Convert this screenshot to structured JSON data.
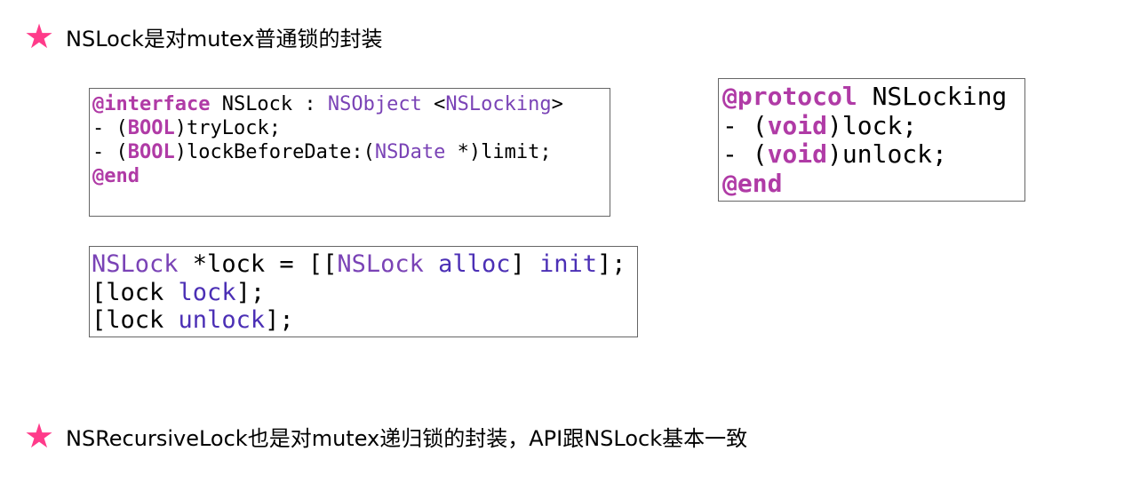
{
  "bullets": [
    {
      "text": "NSLock是对mutex普通锁的封装"
    },
    {
      "text": "NSRecursiveLock也是对mutex递归锁的封装，API跟NSLock基本一致"
    }
  ],
  "star_glyph": "★",
  "colors": {
    "star": "#ff3b8a",
    "keyword": "#b03ba6",
    "type": "#7a43b6",
    "method": "#4b2fb5"
  },
  "code_interface": {
    "lines": [
      [
        {
          "t": "@interface",
          "c": "kw"
        },
        {
          "t": " NSLock : ",
          "c": "pl"
        },
        {
          "t": "NSObject",
          "c": "ty"
        },
        {
          "t": " <",
          "c": "pl"
        },
        {
          "t": "NSLocking",
          "c": "ty"
        },
        {
          "t": ">",
          "c": "pl"
        }
      ],
      [
        {
          "t": "- (",
          "c": "pl"
        },
        {
          "t": "BOOL",
          "c": "kw"
        },
        {
          "t": ")tryLock;",
          "c": "pl"
        }
      ],
      [
        {
          "t": "- (",
          "c": "pl"
        },
        {
          "t": "BOOL",
          "c": "kw"
        },
        {
          "t": ")lockBeforeDate:(",
          "c": "pl"
        },
        {
          "t": "NSDate",
          "c": "ty"
        },
        {
          "t": " *)limit;",
          "c": "pl"
        }
      ],
      [
        {
          "t": "@end",
          "c": "kw"
        }
      ]
    ]
  },
  "code_protocol": {
    "lines": [
      [
        {
          "t": "@protocol",
          "c": "kw"
        },
        {
          "t": " NSLocking",
          "c": "pl"
        }
      ],
      [
        {
          "t": "- (",
          "c": "pl"
        },
        {
          "t": "void",
          "c": "kw"
        },
        {
          "t": ")lock;",
          "c": "pl"
        }
      ],
      [
        {
          "t": "- (",
          "c": "pl"
        },
        {
          "t": "void",
          "c": "kw"
        },
        {
          "t": ")unlock;",
          "c": "pl"
        }
      ],
      [
        {
          "t": "@end",
          "c": "kw"
        }
      ]
    ]
  },
  "code_usage": {
    "lines": [
      [
        {
          "t": "NSLock",
          "c": "ty"
        },
        {
          "t": " *lock = [[",
          "c": "pl"
        },
        {
          "t": "NSLock",
          "c": "ty"
        },
        {
          "t": " ",
          "c": "pl"
        },
        {
          "t": "alloc",
          "c": "fn"
        },
        {
          "t": "] ",
          "c": "pl"
        },
        {
          "t": "init",
          "c": "fn"
        },
        {
          "t": "];",
          "c": "pl"
        }
      ],
      [
        {
          "t": "[lock ",
          "c": "pl"
        },
        {
          "t": "lock",
          "c": "fn"
        },
        {
          "t": "];",
          "c": "pl"
        }
      ],
      [
        {
          "t": "[lock ",
          "c": "pl"
        },
        {
          "t": "unlock",
          "c": "fn"
        },
        {
          "t": "];",
          "c": "pl"
        }
      ]
    ]
  }
}
